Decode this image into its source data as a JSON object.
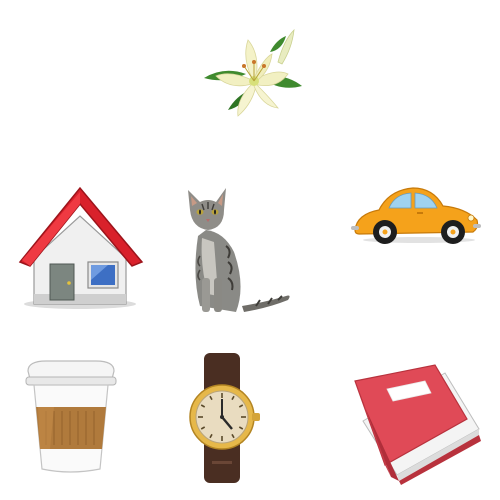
{
  "grid": {
    "rows": 3,
    "columns": 3,
    "cells": [
      {
        "row": 0,
        "col": 0,
        "item": null
      },
      {
        "row": 0,
        "col": 1,
        "item": "lily-flower-icon"
      },
      {
        "row": 0,
        "col": 2,
        "item": null
      },
      {
        "row": 1,
        "col": 0,
        "item": "house-icon"
      },
      {
        "row": 1,
        "col": 1,
        "item": "tabby-cat-icon"
      },
      {
        "row": 1,
        "col": 2,
        "item": "orange-car-icon"
      },
      {
        "row": 2,
        "col": 0,
        "item": "coffee-cup-icon"
      },
      {
        "row": 2,
        "col": 1,
        "item": "wristwatch-icon"
      },
      {
        "row": 2,
        "col": 2,
        "item": "red-book-icon"
      }
    ]
  },
  "colors": {
    "background": "#ffffff",
    "house_roof": "#d9212b",
    "house_wall": "#f0f0f0",
    "car_body": "#f5a21b",
    "book_cover": "#e04a57",
    "cup_sleeve": "#b07a3c",
    "watch_case": "#e6b84a",
    "watch_strap": "#4a2e22",
    "lily_petal": "#f4f2c8",
    "cat_fur": "#8a8a86"
  }
}
